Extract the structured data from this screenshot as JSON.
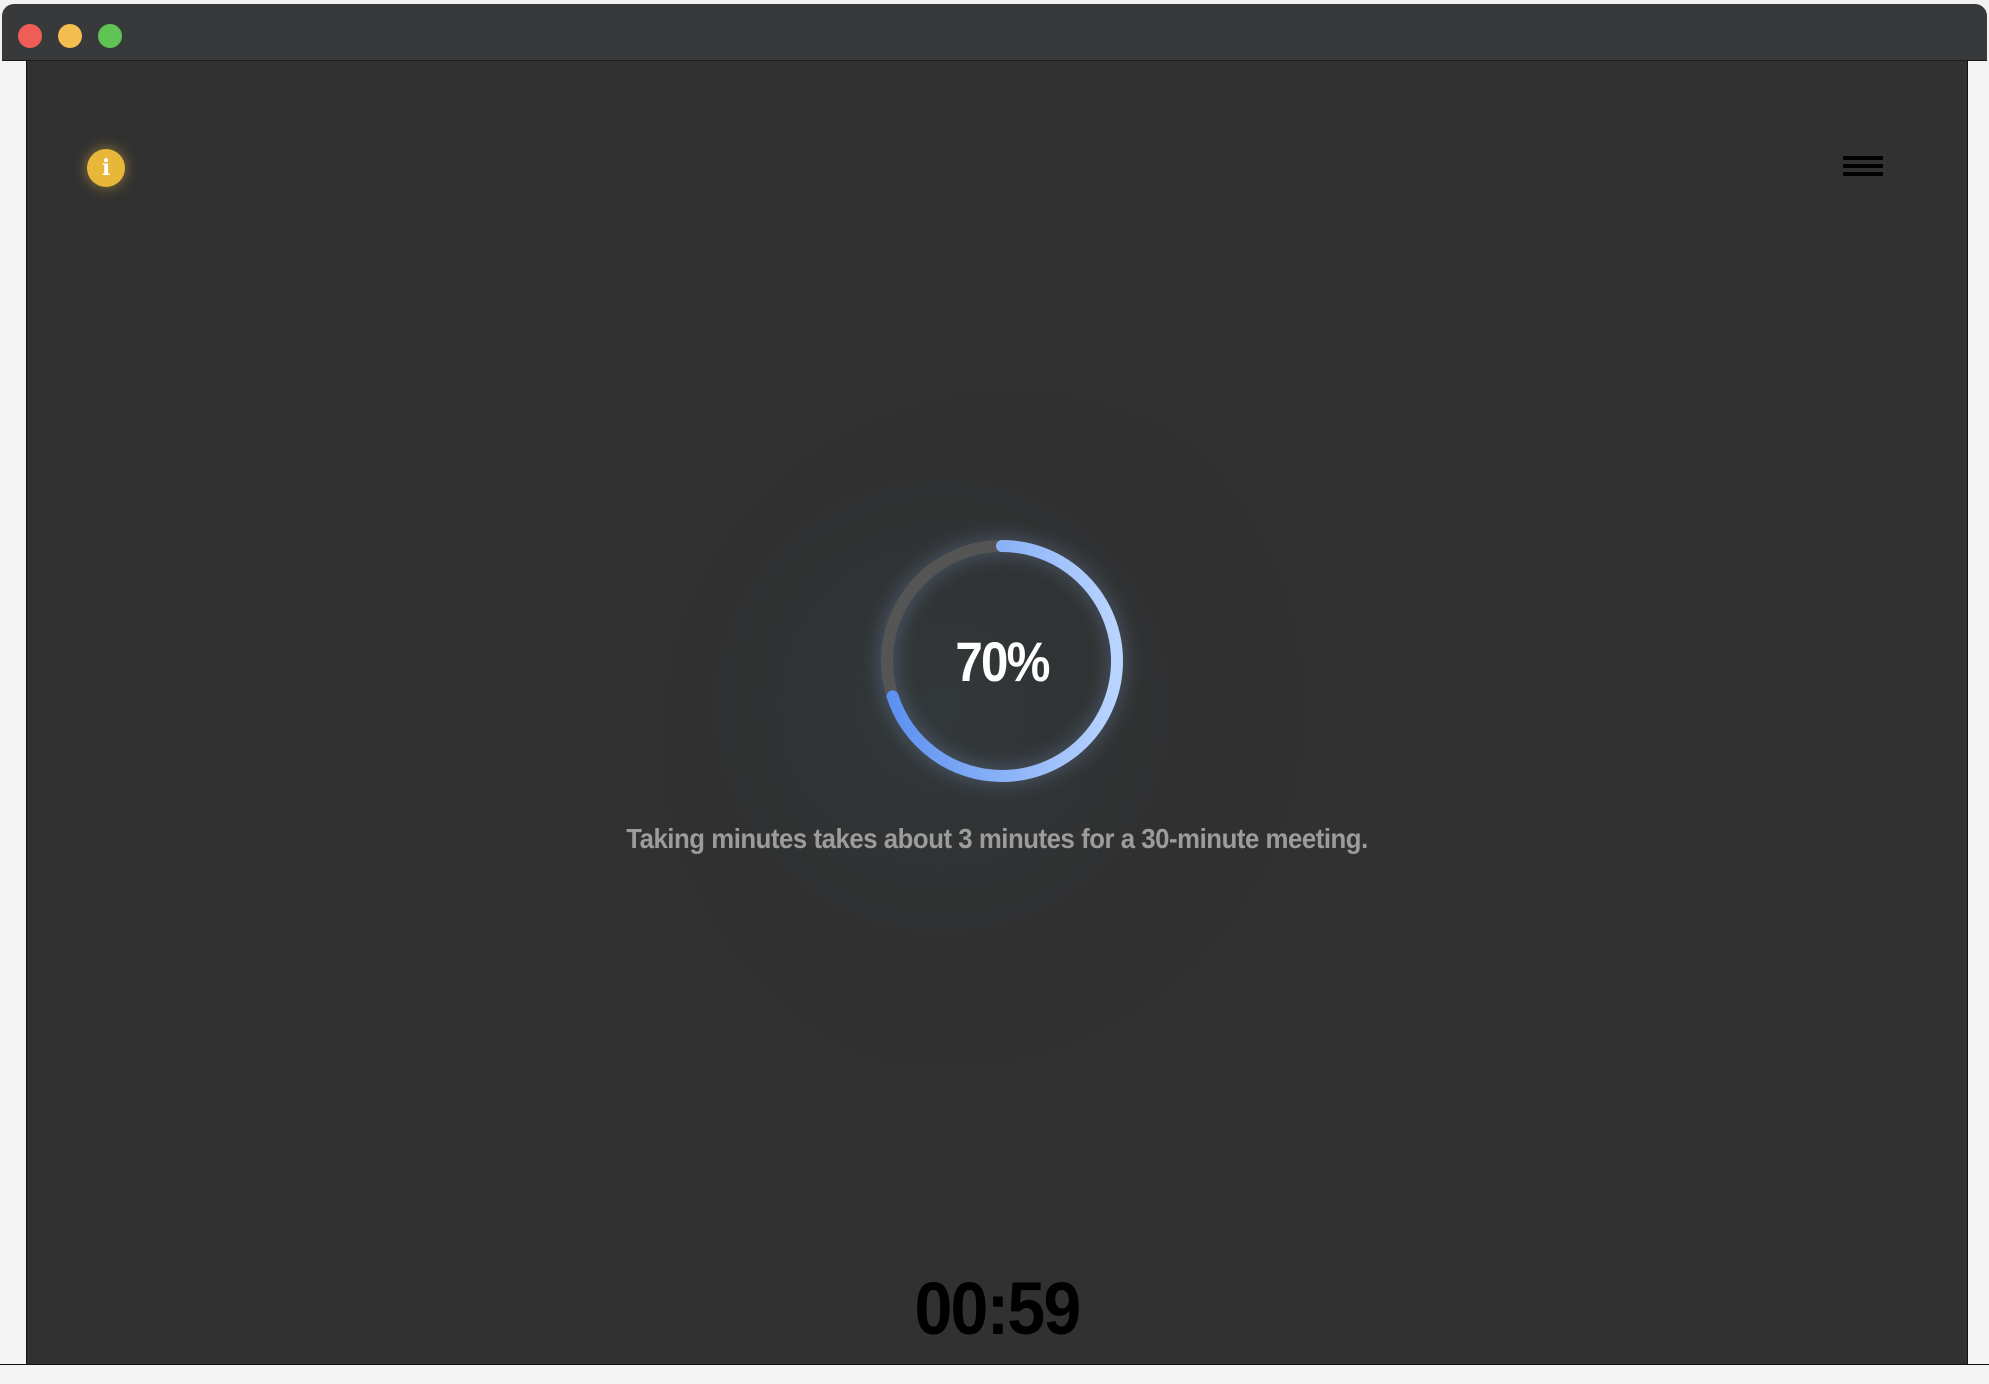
{
  "window": {
    "controls": [
      "close",
      "minimize",
      "zoom"
    ]
  },
  "header": {
    "info_icon": "info-icon",
    "info_glyph": "i",
    "menu_icon": "hamburger-menu-icon"
  },
  "progress": {
    "value": 0.7,
    "label": "70%",
    "track_color": "#555555",
    "gradient_start": "#5b8ff0",
    "gradient_end": "#b9d4ff"
  },
  "caption": "Taking minutes takes about 3 minutes for a 30-minute meeting.",
  "timer": "00:59",
  "colors": {
    "background": "#313131",
    "info_accent": "#e8b73a",
    "caption_text": "#9c9c9c",
    "timer_text": "#000000"
  }
}
